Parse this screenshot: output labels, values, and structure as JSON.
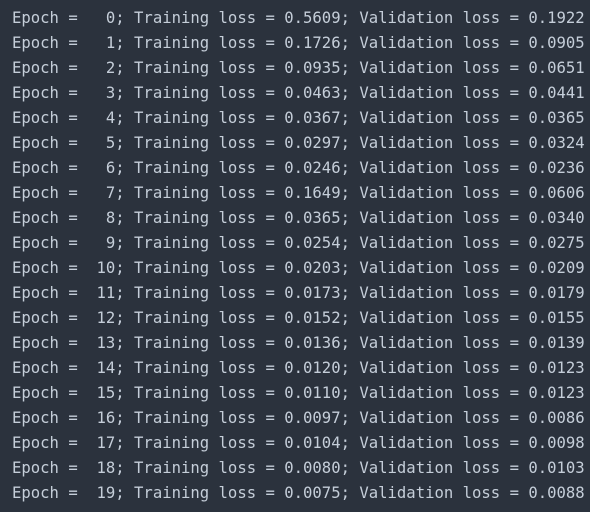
{
  "console": {
    "lines": [
      "Epoch =   0; Training loss = 0.5609; Validation loss = 0.1922",
      "Epoch =   1; Training loss = 0.1726; Validation loss = 0.0905",
      "Epoch =   2; Training loss = 0.0935; Validation loss = 0.0651",
      "Epoch =   3; Training loss = 0.0463; Validation loss = 0.0441",
      "Epoch =   4; Training loss = 0.0367; Validation loss = 0.0365",
      "Epoch =   5; Training loss = 0.0297; Validation loss = 0.0324",
      "Epoch =   6; Training loss = 0.0246; Validation loss = 0.0236",
      "Epoch =   7; Training loss = 0.1649; Validation loss = 0.0606",
      "Epoch =   8; Training loss = 0.0365; Validation loss = 0.0340",
      "Epoch =   9; Training loss = 0.0254; Validation loss = 0.0275",
      "Epoch =  10; Training loss = 0.0203; Validation loss = 0.0209",
      "Epoch =  11; Training loss = 0.0173; Validation loss = 0.0179",
      "Epoch =  12; Training loss = 0.0152; Validation loss = 0.0155",
      "Epoch =  13; Training loss = 0.0136; Validation loss = 0.0139",
      "Epoch =  14; Training loss = 0.0120; Validation loss = 0.0123",
      "Epoch =  15; Training loss = 0.0110; Validation loss = 0.0123",
      "Epoch =  16; Training loss = 0.0097; Validation loss = 0.0086",
      "Epoch =  17; Training loss = 0.0104; Validation loss = 0.0098",
      "Epoch =  18; Training loss = 0.0080; Validation loss = 0.0103",
      "Epoch =  19; Training loss = 0.0075; Validation loss = 0.0088"
    ]
  },
  "colors": {
    "background": "#2b323d",
    "text": "#c5ced9"
  }
}
